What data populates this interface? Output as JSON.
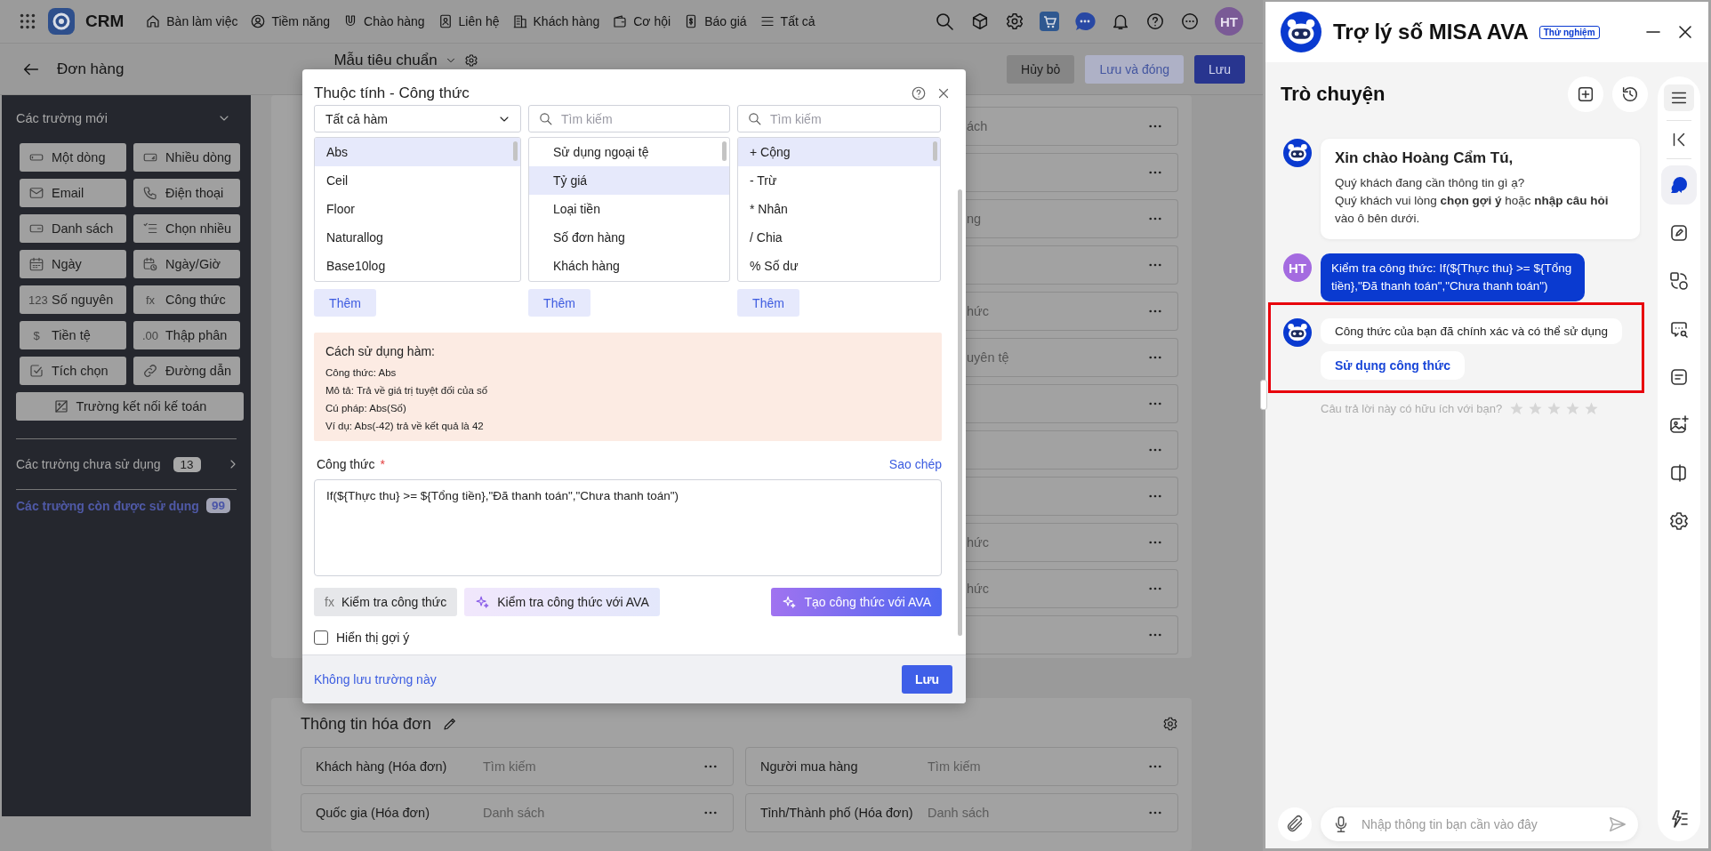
{
  "topbar": {
    "app_name": "CRM",
    "nav": [
      {
        "label": "Bàn làm việc"
      },
      {
        "label": "Tiềm năng"
      },
      {
        "label": "Chào hàng"
      },
      {
        "label": "Liên hệ"
      },
      {
        "label": "Khách hàng"
      },
      {
        "label": "Cơ hội"
      },
      {
        "label": "Báo giá"
      },
      {
        "label": "Tất cả"
      }
    ],
    "avatar": "HT"
  },
  "subbar": {
    "title": "Đơn hàng",
    "layout_name": "Mẫu tiêu chuẩn",
    "buttons": [
      {
        "label": "Hủy bỏ",
        "kind": "secondary"
      },
      {
        "label": "Lưu và đóng",
        "kind": "soft"
      },
      {
        "label": "Lưu",
        "kind": "primary"
      }
    ]
  },
  "sidebar": {
    "section_title": "Các trường mới",
    "expanded": true,
    "fields": [
      {
        "label": "Một dòng"
      },
      {
        "label": "Nhiều dòng"
      },
      {
        "label": "Email"
      },
      {
        "label": "Điện thoại"
      },
      {
        "label": "Danh sách"
      },
      {
        "label": "Chọn nhiều"
      },
      {
        "label": "Ngày"
      },
      {
        "label": "Ngày/Giờ"
      },
      {
        "label": "Số nguyên",
        "glyph": "123"
      },
      {
        "label": "Công thức",
        "glyph": "fx"
      },
      {
        "label": "Tiền tệ",
        "glyph": "$"
      },
      {
        "label": "Thập phân",
        "glyph": ".00"
      },
      {
        "label": "Tích chọn"
      },
      {
        "label": "Đường dẫn"
      }
    ],
    "wide_field": "Trường kết nối kế toán",
    "unused": {
      "label": "Các trường chưa sử dụng",
      "count": "13"
    },
    "remaining": {
      "label": "Các trường còn được sử dụng",
      "count": "99"
    }
  },
  "form": {
    "rows": [
      {
        "kind": "field",
        "text": "ách"
      },
      {
        "kind": "field"
      },
      {
        "kind": "field",
        "text": "ng"
      },
      {
        "kind": "field"
      },
      {
        "kind": "field",
        "text": "hức"
      },
      {
        "kind": "field",
        "text": "uyên tệ"
      },
      {
        "kind": "field"
      },
      {
        "kind": "field"
      },
      {
        "kind": "field"
      },
      {
        "kind": "field",
        "text": "hức"
      },
      {
        "kind": "field",
        "text": "hức"
      },
      {
        "kind": "field"
      }
    ],
    "invoice_section": {
      "title": "Thông tin hóa đơn",
      "fields": [
        {
          "label": "Khách hàng (Hóa đơn)",
          "placeholder": "Tìm kiếm"
        },
        {
          "label": "Người mua hàng",
          "placeholder": "Tìm kiếm"
        },
        {
          "label": "Quốc gia (Hóa đơn)",
          "placeholder": "Danh sách"
        },
        {
          "label": "Tỉnh/Thành phố (Hóa đơn)",
          "placeholder": "Danh sách"
        }
      ]
    }
  },
  "formula_dialog": {
    "title": "Thuộc tính - Công thức",
    "columns": [
      {
        "kind": "dropdown",
        "value": "Tất cả hàm",
        "items": [
          {
            "label": "Abs",
            "selected": true
          },
          {
            "label": "Ceil",
            "selected": false
          },
          {
            "label": "Floor",
            "selected": false
          },
          {
            "label": "Naturallog",
            "selected": false
          },
          {
            "label": "Base10log",
            "selected": false
          }
        ],
        "add_button": "Thêm"
      },
      {
        "kind": "search",
        "placeholder": "Tìm kiếm",
        "items": [
          {
            "label": "Sử dụng ngoại tệ",
            "selected": false
          },
          {
            "label": "Tỷ giá",
            "selected": true
          },
          {
            "label": "Loại tiền",
            "selected": false
          },
          {
            "label": "Số đơn hàng",
            "selected": false
          },
          {
            "label": "Khách hàng",
            "selected": false
          }
        ],
        "add_button": "Thêm"
      },
      {
        "kind": "search",
        "placeholder": "Tìm kiếm",
        "items": [
          {
            "label": "+ Cộng",
            "selected": true
          },
          {
            "label": "- Trừ",
            "selected": false
          },
          {
            "label": "* Nhân",
            "selected": false
          },
          {
            "label": "/ Chia",
            "selected": false
          },
          {
            "label": "% Số dư",
            "selected": false
          }
        ],
        "add_button": "Thêm"
      }
    ],
    "usage": {
      "title": "Cách sử dụng hàm:",
      "lines": [
        "Công thức: Abs",
        "Mô tả: Trả về giá trị tuyệt đối của số",
        "Cú pháp: Abs(Số)",
        "Ví dụ: Abs(-42) trả về kết quả là 42"
      ]
    },
    "formula_label": "Công thức",
    "required_mark": "*",
    "copy_link": "Sao chép",
    "formula": "If(${Thực thu} >= ${Tổng tiền},\"Đã thanh toán\",\"Chưa thanh toán\")",
    "buttons": [
      {
        "label": "Kiểm tra công thức",
        "kind": "plain",
        "glyph": "fx"
      },
      {
        "label": "Kiểm tra công thức với AVA",
        "kind": "ava-soft"
      },
      {
        "label": "Tạo công thức với AVA",
        "kind": "ava"
      }
    ],
    "show_hints": {
      "label": "Hiển thị gợi ý",
      "checked": false
    },
    "footer": {
      "discard_link": "Không lưu trường này",
      "save": "Lưu"
    }
  },
  "assistant": {
    "title": "Trợ lý số MISA AVA",
    "badge": "Thử nghiệm",
    "section_title": "Trò chuyện",
    "messages": [
      {
        "kind": "bot-card",
        "heading": "Xin chào Hoàng Cẩm Tú,",
        "lines": [
          "Quý khách đang cần thông tin gì ạ?",
          "Quý khách vui lòng **chọn gợi ý** hoặc **nhập câu hỏi** vào ô bên dưới."
        ]
      },
      {
        "kind": "user",
        "avatar": "HT",
        "text": "Kiểm tra công thức: If(${Thực thu} >= ${Tổng tiền},\"Đã thanh toán\",\"Chưa thanh toán\")"
      },
      {
        "kind": "bot-reply",
        "text": "Công thức của bạn đã chính xác và có thể sử dụng",
        "action": "Sử dụng công thức",
        "highlighted": true
      }
    ],
    "feedback": {
      "question": "Câu trả lời này có hữu ích với bạn?",
      "stars": 0
    },
    "input_placeholder": "Nhập thông tin bạn cần vào đây",
    "rail": [
      {
        "selected": true
      },
      {
        "selected": false
      },
      {
        "selected": false
      },
      {
        "selected": false
      },
      {
        "selected": false
      },
      {
        "selected": false
      },
      {
        "selected": false
      },
      {
        "selected": false
      }
    ]
  }
}
